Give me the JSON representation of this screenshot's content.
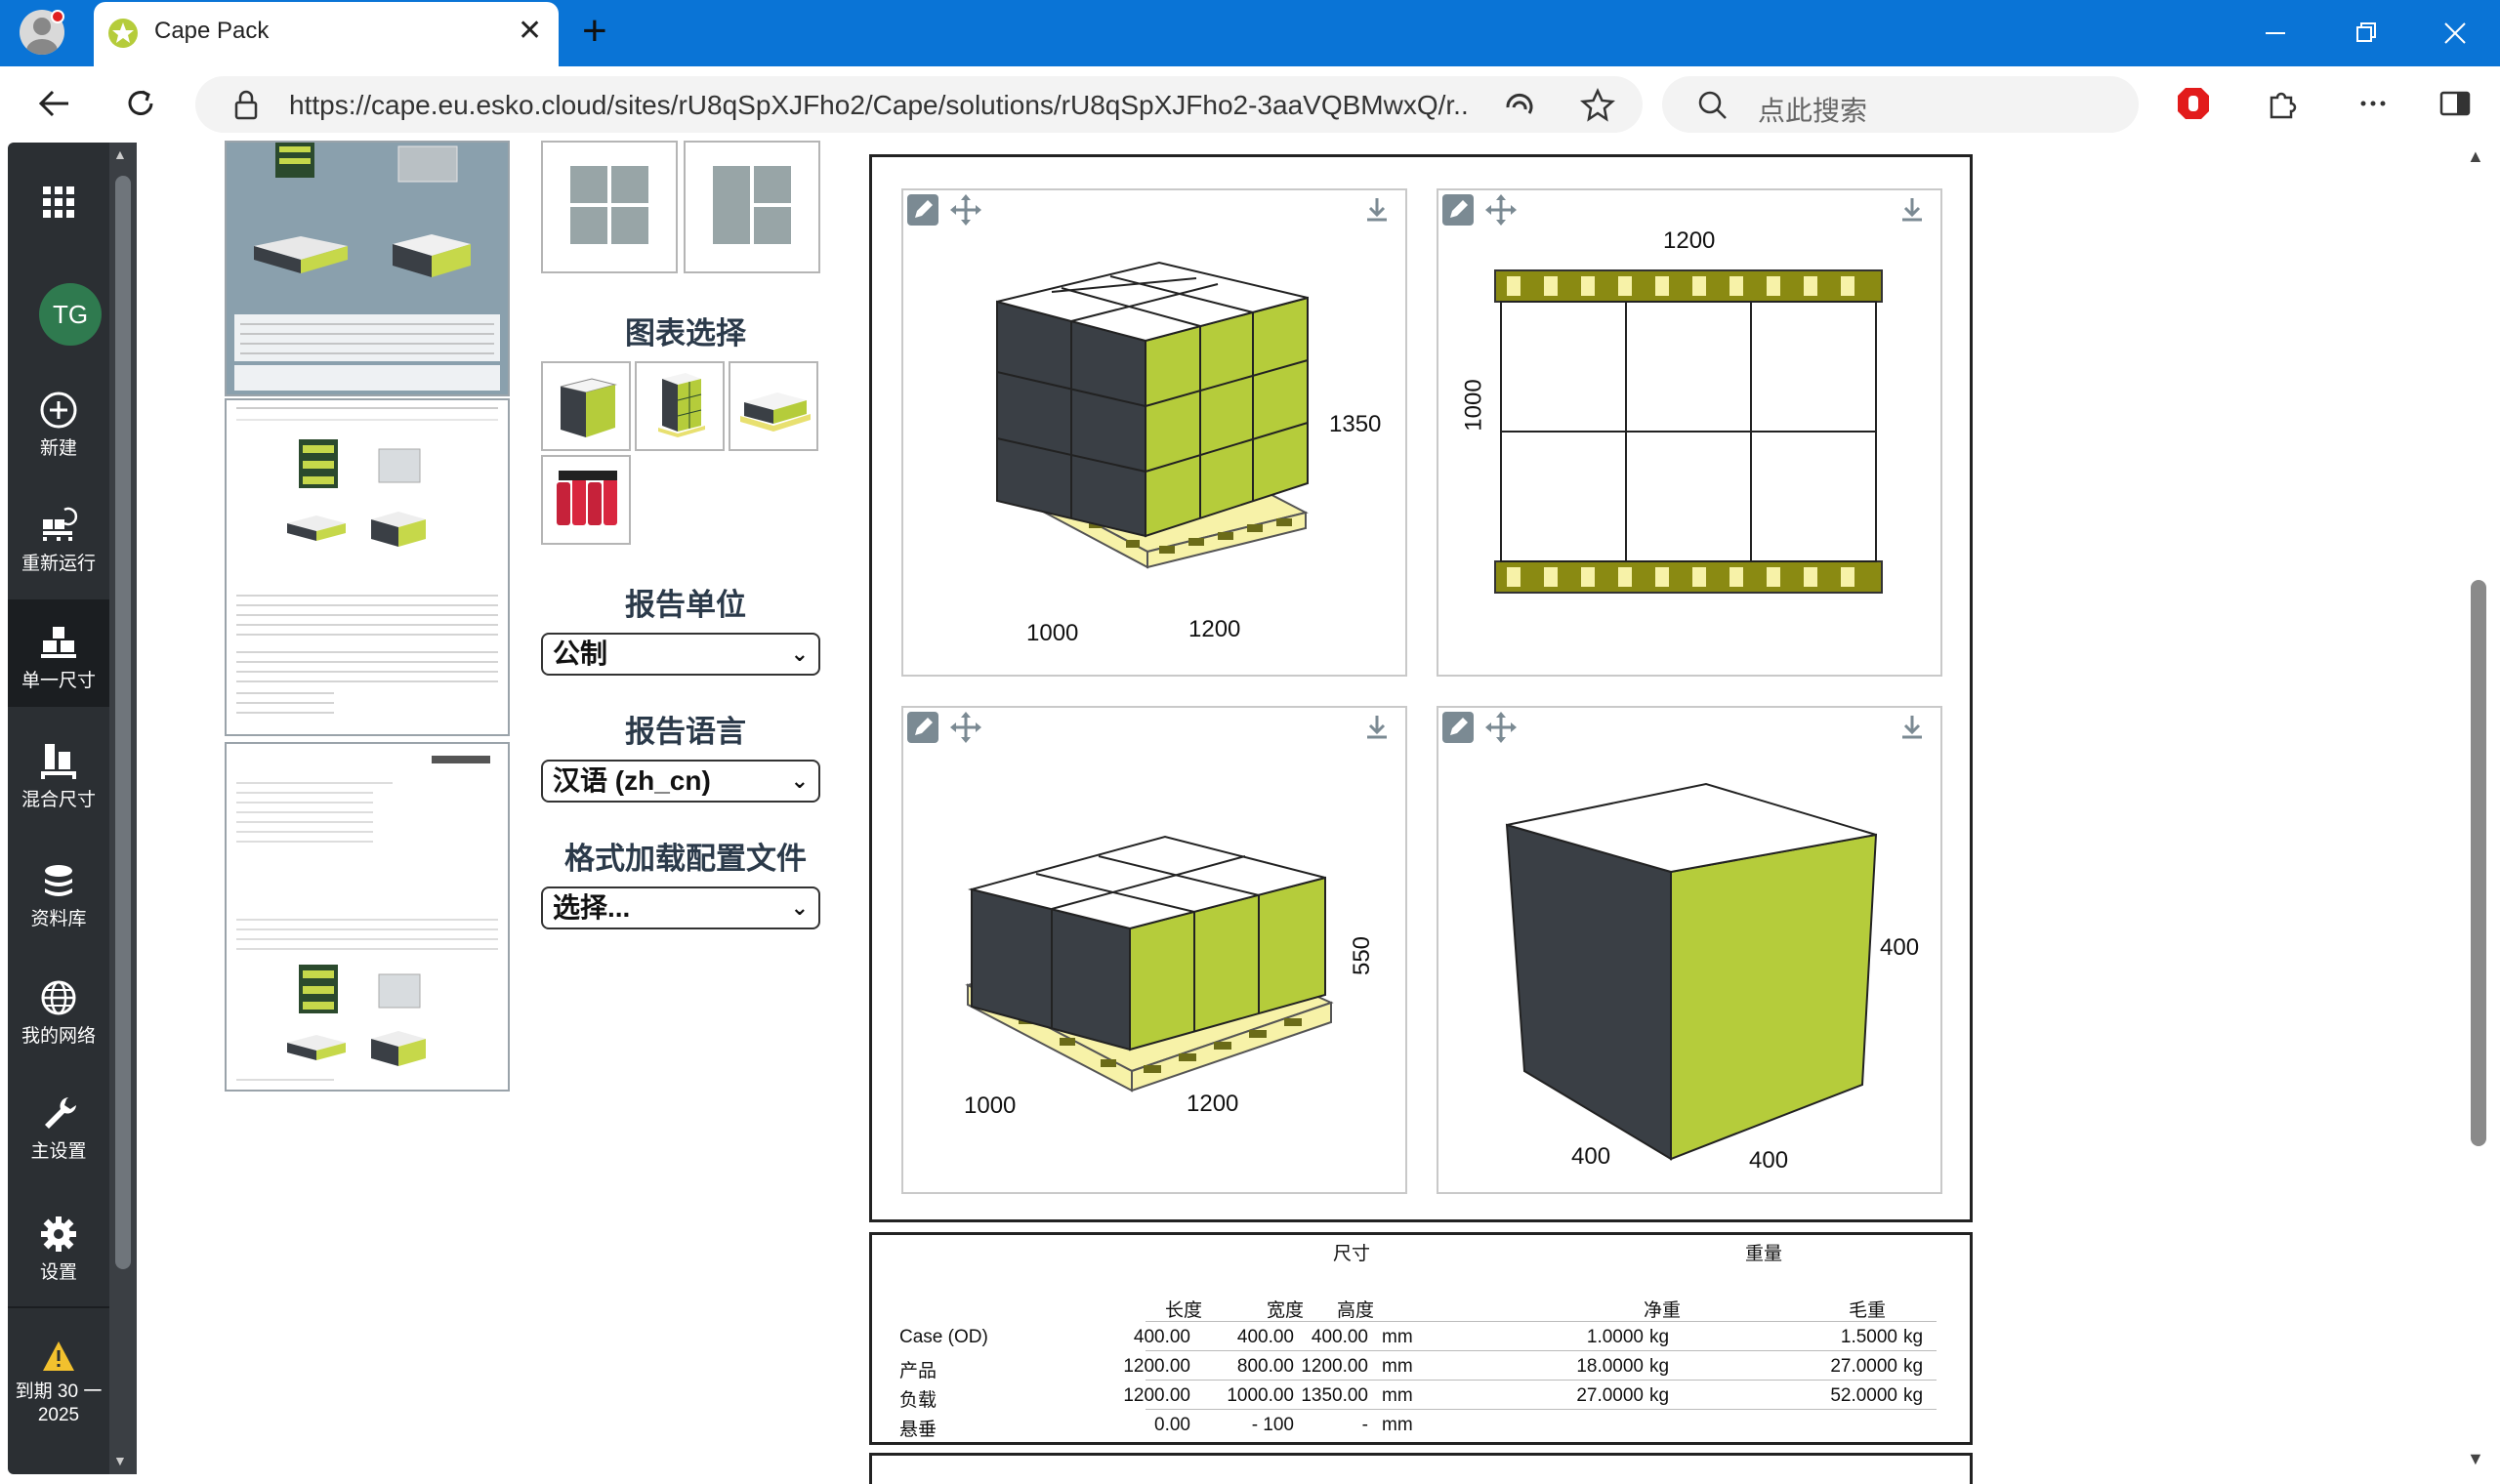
{
  "browser": {
    "tab_title": "Cape Pack",
    "address": "https://cape.eu.esko.cloud/sites/rU8qSpXJFho2/Cape/solutions/rU8qSpXJFho2-3aaVQBMwxQ/r...",
    "search_placeholder": "点此搜索"
  },
  "nav": {
    "avatar": "TG",
    "items": [
      {
        "label": "新建"
      },
      {
        "label": "重新运行"
      },
      {
        "label": "单一尺寸"
      },
      {
        "label": "混合尺寸"
      },
      {
        "label": "资料库"
      },
      {
        "label": "我的网络"
      },
      {
        "label": "主设置"
      },
      {
        "label": "设置"
      }
    ],
    "expiry_line1": "到期 30 一",
    "expiry_line2": "2025"
  },
  "options": {
    "chart_select_title": "图表选择",
    "report_unit_title": "报告单位",
    "report_unit_value": "公制",
    "report_language_title": "报告语言",
    "report_language_value": "汉语 (zh_cn)",
    "format_profile_title": "格式加载配置文件",
    "format_profile_value": "选择..."
  },
  "diagrams": {
    "d1": {
      "width": "1000",
      "length": "1200",
      "height": "1350"
    },
    "d2": {
      "top": "1200",
      "side": "1000"
    },
    "d3": {
      "width": "1000",
      "length": "1200",
      "height": "550"
    },
    "d4": {
      "a": "400",
      "b": "400",
      "c": "400"
    }
  },
  "table": {
    "group_dims": "尺寸",
    "group_weight": "重量",
    "headers": [
      "长度",
      "宽度",
      "高度",
      "净重",
      "毛重"
    ],
    "rows": [
      {
        "name": "Case (OD)",
        "l": "400.00",
        "w": "400.00",
        "h": "400.00",
        "u1": "mm",
        "net": "1.0000",
        "u2": "kg",
        "gross": "1.5000",
        "u3": "kg"
      },
      {
        "name": "产品",
        "l": "1200.00",
        "w": "800.00",
        "h": "1200.00",
        "u1": "mm",
        "net": "18.0000",
        "u2": "kg",
        "gross": "27.0000",
        "u3": "kg"
      },
      {
        "name": "负载",
        "l": "1200.00",
        "w": "1000.00",
        "h": "1350.00",
        "u1": "mm",
        "net": "27.0000",
        "u2": "kg",
        "gross": "52.0000",
        "u3": "kg"
      },
      {
        "name": "悬垂",
        "l": "0.00",
        "w": "- 100",
        "h": "-",
        "u1": "mm",
        "net": "",
        "u2": "",
        "gross": "",
        "u3": ""
      }
    ]
  },
  "colors": {
    "accent": "#0a74d6",
    "box_face": "#b5cc3b",
    "box_side": "#3a3f45",
    "pallet": "#f5f0a0"
  }
}
